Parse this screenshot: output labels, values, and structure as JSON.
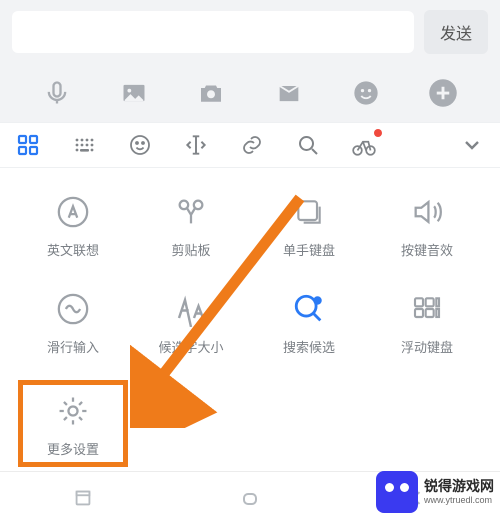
{
  "top": {
    "send_label": "发送"
  },
  "grid": [
    {
      "label": "英文联想"
    },
    {
      "label": "剪贴板"
    },
    {
      "label": "单手键盘"
    },
    {
      "label": "按键音效"
    },
    {
      "label": "滑行输入"
    },
    {
      "label": "候选字大小"
    },
    {
      "label": "搜索候选"
    },
    {
      "label": "浮动键盘"
    },
    {
      "label": "更多设置"
    }
  ],
  "watermark": {
    "brand": "锐得游戏网",
    "url": "www.ytruedl.com"
  }
}
